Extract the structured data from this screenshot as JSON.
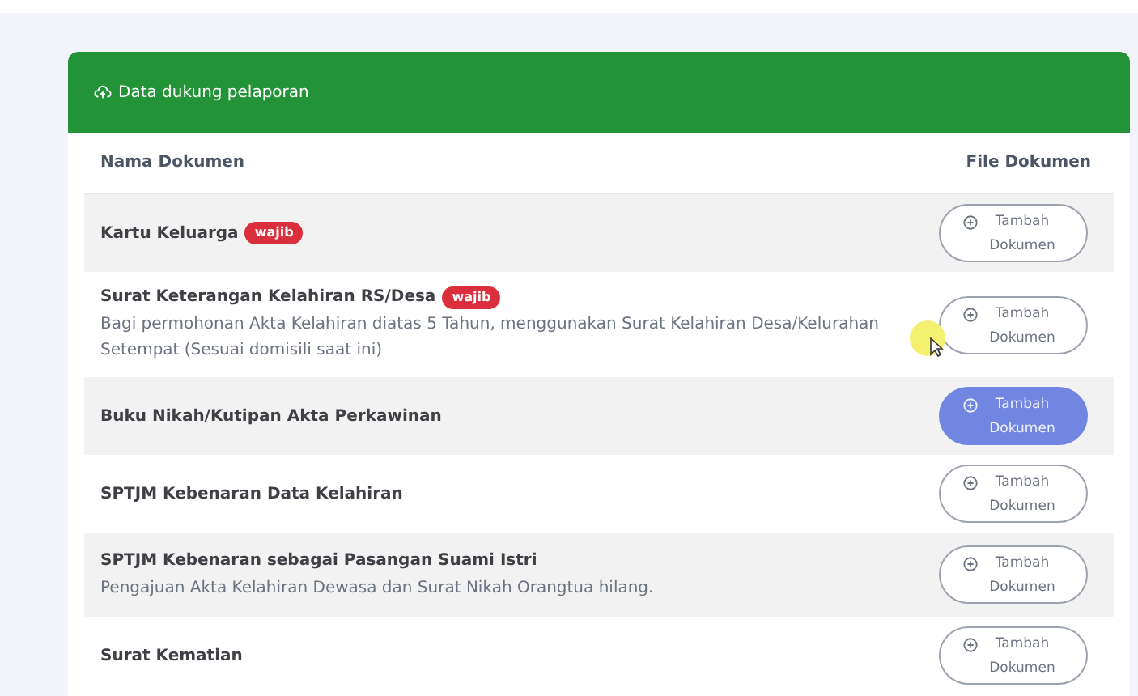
{
  "card": {
    "title": "Data dukung pelaporan"
  },
  "table": {
    "columns": [
      "Nama Dokumen",
      "File Dokumen"
    ],
    "rows": [
      {
        "name": "Kartu Keluarga",
        "badge": "wajib",
        "button": "Tambah Dokumen",
        "highlighted": false
      },
      {
        "name": "Surat Keterangan Kelahiran RS/Desa",
        "badge": "wajib",
        "note": "Bagi permohonan Akta Kelahiran diatas 5 Tahun, menggunakan Surat Kelahiran Desa/Kelurahan Setempat (Sesuai domisili saat ini)",
        "button": "Tambah Dokumen",
        "highlighted": false
      },
      {
        "name": "Buku Nikah/Kutipan Akta Perkawinan",
        "button": "Tambah Dokumen",
        "highlighted": true
      },
      {
        "name": "SPTJM Kebenaran Data Kelahiran",
        "button": "Tambah Dokumen",
        "highlighted": false
      },
      {
        "name": "SPTJM Kebenaran sebagai Pasangan Suami Istri",
        "note": "Pengajuan Akta Kelahiran Dewasa dan Surat Nikah Orangtua hilang.",
        "button": "Tambah Dokumen",
        "highlighted": false
      },
      {
        "name": "Surat Kematian",
        "button": "Tambah Dokumen",
        "highlighted": false
      }
    ]
  }
}
